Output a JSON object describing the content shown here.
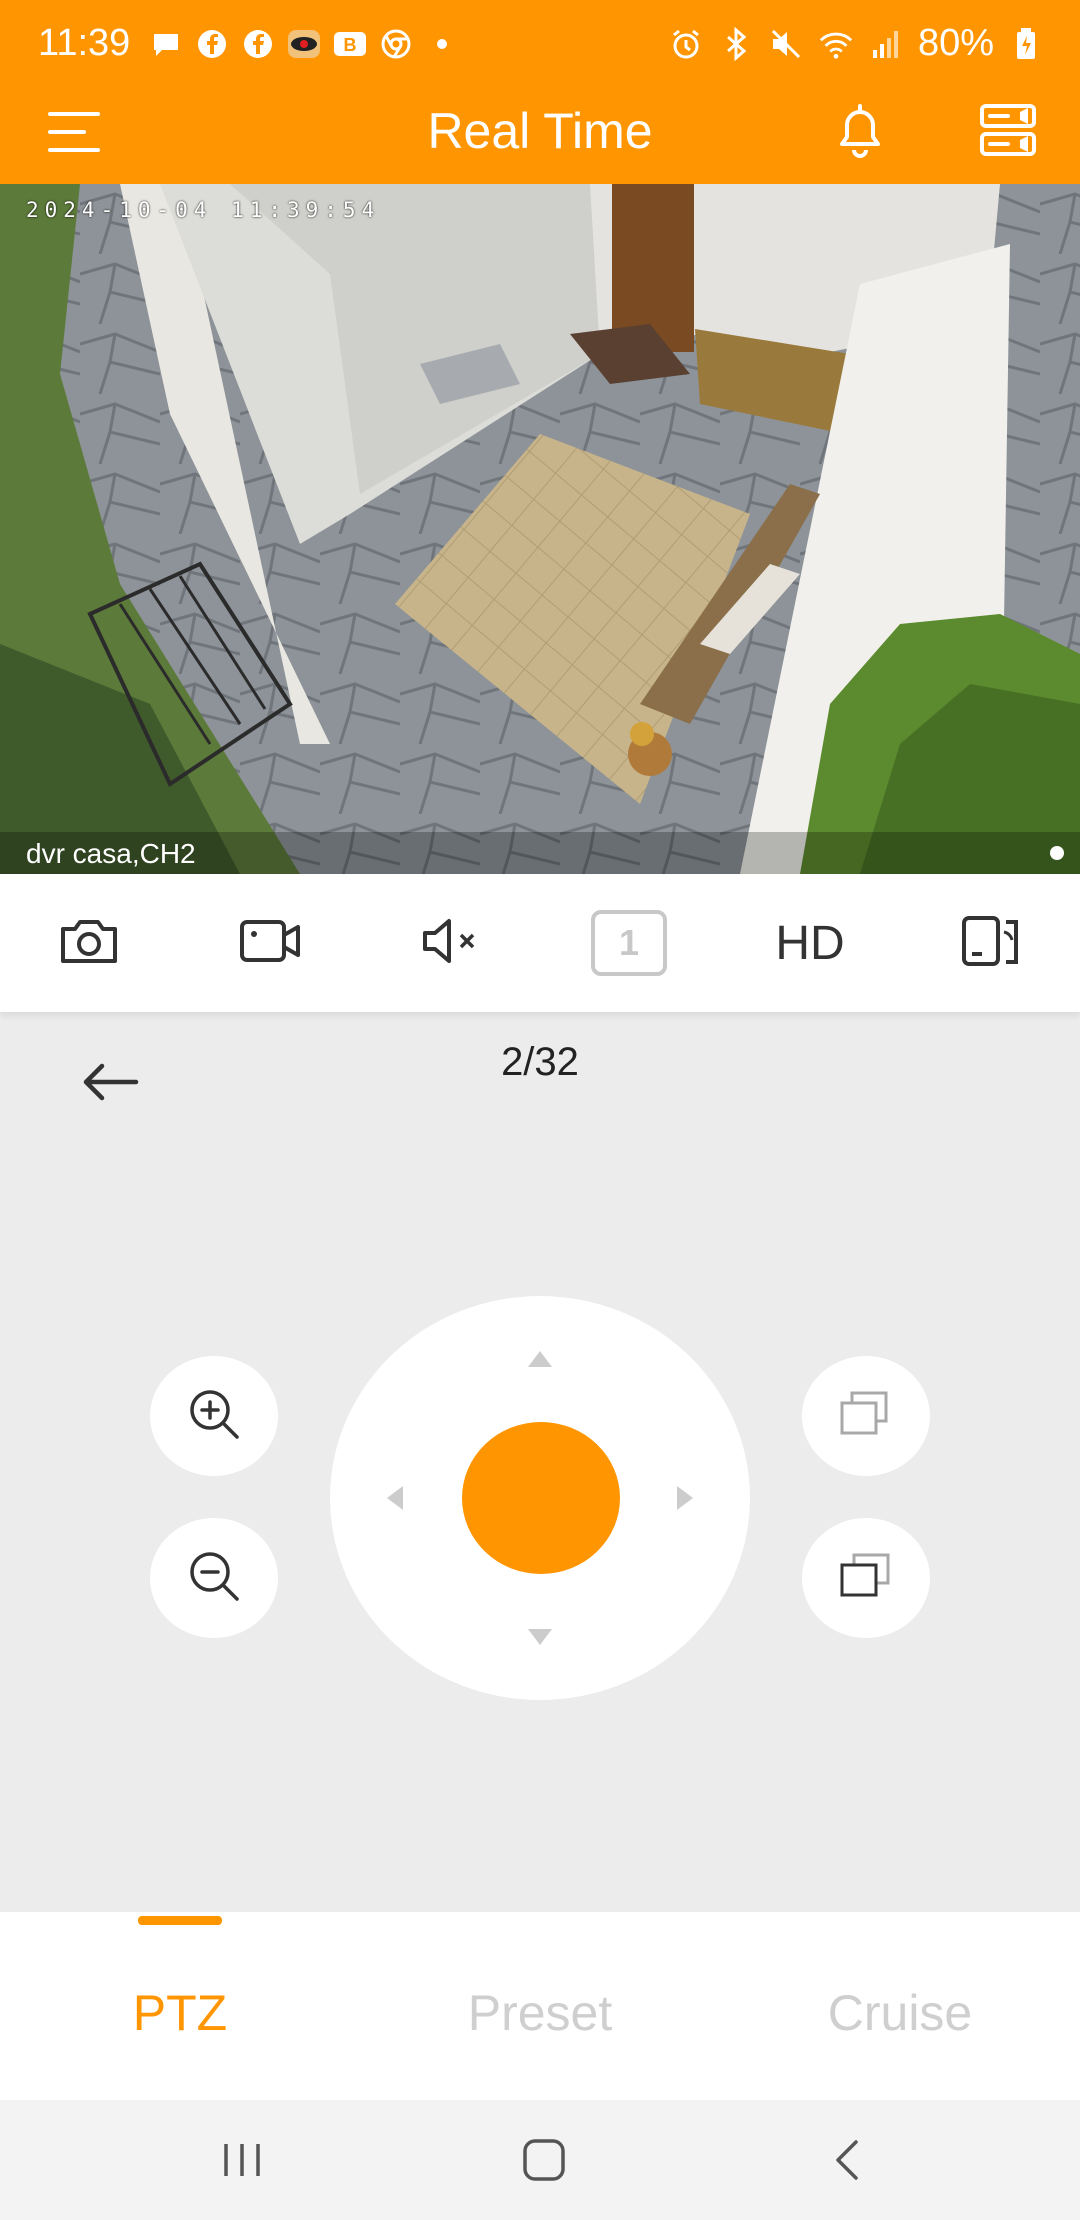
{
  "status_bar": {
    "time": "11:39",
    "battery": "80%",
    "left_icons": [
      "chat-bubble-icon",
      "facebook-icon",
      "facebook-icon",
      "eye-app-icon",
      "b-app-icon",
      "chrome-icon",
      "dot-icon"
    ],
    "right_icons": [
      "alarm-icon",
      "bluetooth-icon",
      "mute-icon",
      "wifi-icon",
      "signal-icon",
      "battery-icon"
    ]
  },
  "header": {
    "title": "Real Time",
    "accent_color": "#ff9500"
  },
  "video": {
    "timestamp": "2024-10-04  11:39:54",
    "caption": "dvr casa,CH2"
  },
  "toolbar": {
    "split_label": "1",
    "quality_label": "HD",
    "icons": [
      "camera-icon",
      "record-icon",
      "mute-icon",
      "split-icon",
      "hd-label",
      "rotate-icon"
    ]
  },
  "ptz": {
    "channel_count": "2/32"
  },
  "tabs": {
    "items": [
      {
        "label": "PTZ",
        "active": true
      },
      {
        "label": "Preset",
        "active": false
      },
      {
        "label": "Cruise",
        "active": false
      }
    ]
  }
}
